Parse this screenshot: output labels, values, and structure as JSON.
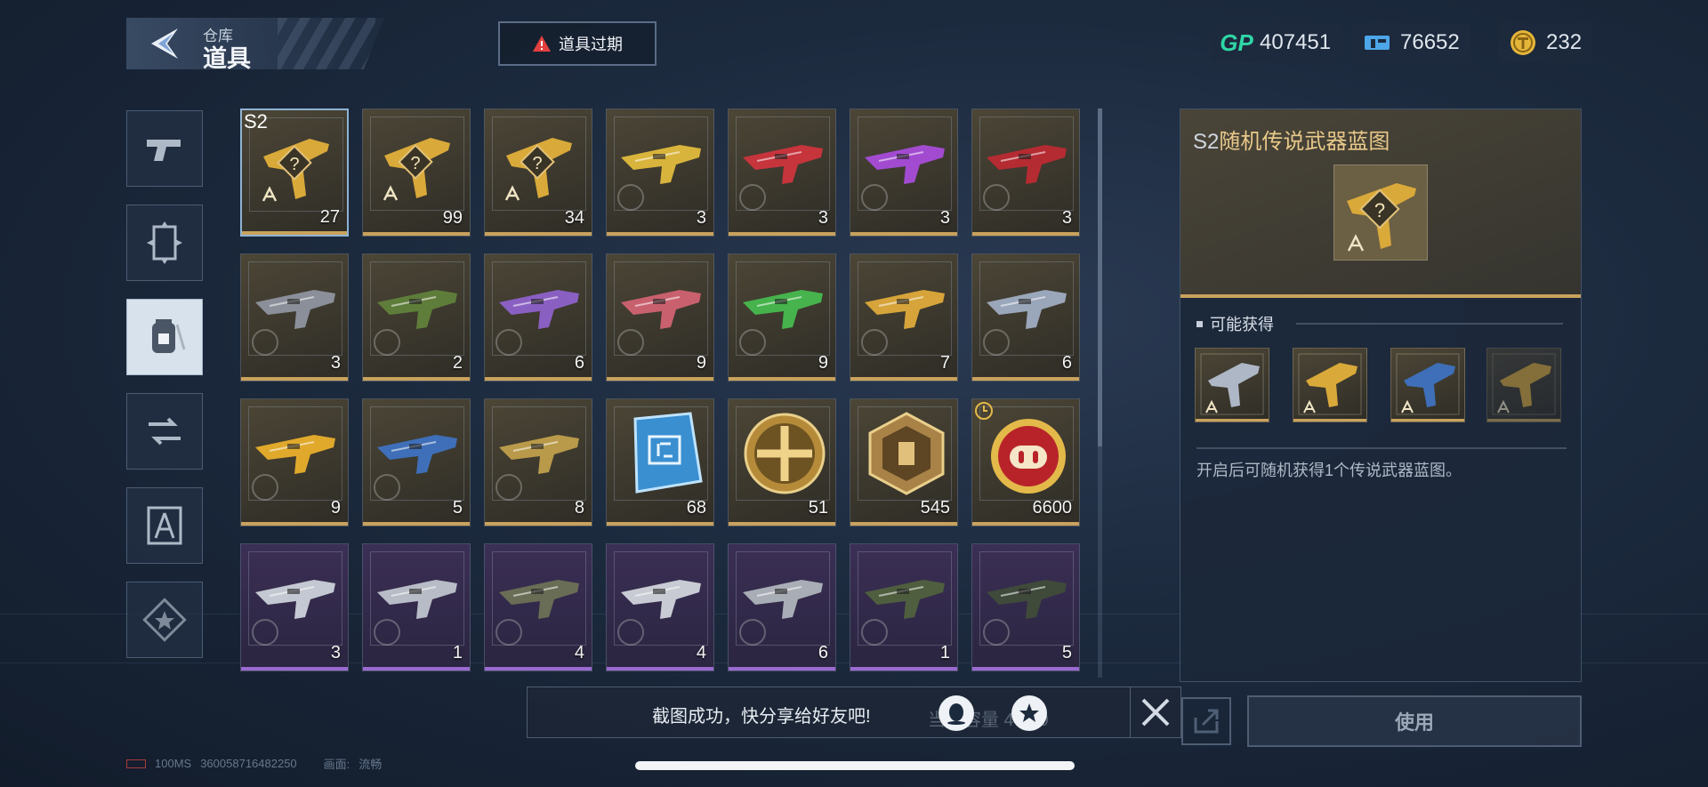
{
  "header": {
    "breadcrumb_parent": "仓库",
    "title": "道具",
    "expire_button": "道具过期"
  },
  "currencies": [
    {
      "icon": "gp-icon",
      "label": "GP",
      "value": "407451",
      "color": "#2fd6a6"
    },
    {
      "icon": "ticket-icon",
      "value": "76652",
      "color": "#4da6e8"
    },
    {
      "icon": "gold-coin-icon",
      "value": "232",
      "color": "#e4b63a"
    }
  ],
  "sidebar": [
    {
      "name": "sidebar-weapons",
      "icon": "pistol-icon"
    },
    {
      "name": "sidebar-cards",
      "icon": "card-icon"
    },
    {
      "name": "sidebar-items",
      "icon": "item-canister-icon",
      "active": true
    },
    {
      "name": "sidebar-exchange",
      "icon": "exchange-icon"
    },
    {
      "name": "sidebar-blueprints",
      "icon": "compass-icon"
    },
    {
      "name": "sidebar-favorites",
      "icon": "star-icon"
    }
  ],
  "items": [
    {
      "kind": "blueprint",
      "count": "27",
      "tag": "S2",
      "rarity": "gold",
      "selected": true
    },
    {
      "kind": "blueprint",
      "count": "99",
      "rarity": "gold"
    },
    {
      "kind": "blueprint",
      "count": "34",
      "rarity": "gold"
    },
    {
      "kind": "weapon",
      "count": "3",
      "rarity": "gold",
      "tint": "#d9b43c"
    },
    {
      "kind": "weapon",
      "count": "3",
      "rarity": "gold",
      "tint": "#c6343c"
    },
    {
      "kind": "weapon",
      "count": "3",
      "rarity": "gold",
      "tint": "#a24bd0"
    },
    {
      "kind": "weapon",
      "count": "3",
      "rarity": "gold",
      "tint": "#b52b32"
    },
    {
      "kind": "weapon",
      "count": "3",
      "rarity": "gold",
      "tint": "#8a8f99"
    },
    {
      "kind": "weapon",
      "count": "2",
      "rarity": "gold",
      "tint": "#5f7d3a"
    },
    {
      "kind": "weapon",
      "count": "6",
      "rarity": "gold",
      "tint": "#8a5fc2"
    },
    {
      "kind": "weapon",
      "count": "9",
      "rarity": "gold",
      "tint": "#c9606e"
    },
    {
      "kind": "weapon",
      "count": "9",
      "rarity": "gold",
      "tint": "#46b34c"
    },
    {
      "kind": "weapon",
      "count": "7",
      "rarity": "gold",
      "tint": "#d6a43a"
    },
    {
      "kind": "weapon",
      "count": "6",
      "rarity": "gold",
      "tint": "#9aa6ba"
    },
    {
      "kind": "weapon",
      "count": "9",
      "rarity": "gold",
      "tint": "#e0a92b"
    },
    {
      "kind": "weapon",
      "count": "5",
      "rarity": "gold",
      "tint": "#3e6fb8"
    },
    {
      "kind": "weapon",
      "count": "8",
      "rarity": "gold",
      "tint": "#b89a4a"
    },
    {
      "kind": "chip",
      "count": "68",
      "rarity": "gold"
    },
    {
      "kind": "medal",
      "count": "51",
      "rarity": "gold"
    },
    {
      "kind": "hex-token",
      "count": "545",
      "rarity": "gold"
    },
    {
      "kind": "pig-coin",
      "count": "6600",
      "rarity": "gold",
      "timer": true
    },
    {
      "kind": "weapon",
      "count": "3",
      "rarity": "purple",
      "tint": "#c4c8d2"
    },
    {
      "kind": "weapon",
      "count": "1",
      "rarity": "purple",
      "tint": "#b7bcc6"
    },
    {
      "kind": "weapon",
      "count": "4",
      "rarity": "purple",
      "tint": "#6a6d55"
    },
    {
      "kind": "weapon",
      "count": "4",
      "rarity": "purple",
      "tint": "#c8cbd3"
    },
    {
      "kind": "weapon",
      "count": "6",
      "rarity": "purple",
      "tint": "#a9adb6"
    },
    {
      "kind": "weapon",
      "count": "1",
      "rarity": "purple",
      "tint": "#4f5e3e"
    },
    {
      "kind": "weapon",
      "count": "5",
      "rarity": "purple",
      "tint": "#3f4a3a"
    }
  ],
  "detail": {
    "title_prefix": "S2",
    "title": "随机传说武器蓝图",
    "section_label": "可能获得",
    "description": "开启后可随机获得1个传说武器蓝图。",
    "loot": [
      {
        "icon": "blade-blueprint-icon"
      },
      {
        "icon": "rifle-blueprint-icon"
      },
      {
        "icon": "smg-blueprint-icon"
      },
      {
        "icon": "rifle-blueprint-icon"
      }
    ]
  },
  "use_button": "使用",
  "toast": {
    "message": "截图成功，快分享给好友吧!",
    "capacity_ghost": "当前容量 4  500"
  },
  "footer": {
    "ping": "100MS",
    "uid": "360058716482250",
    "quality_label": "画面:",
    "quality_value": "流畅"
  }
}
